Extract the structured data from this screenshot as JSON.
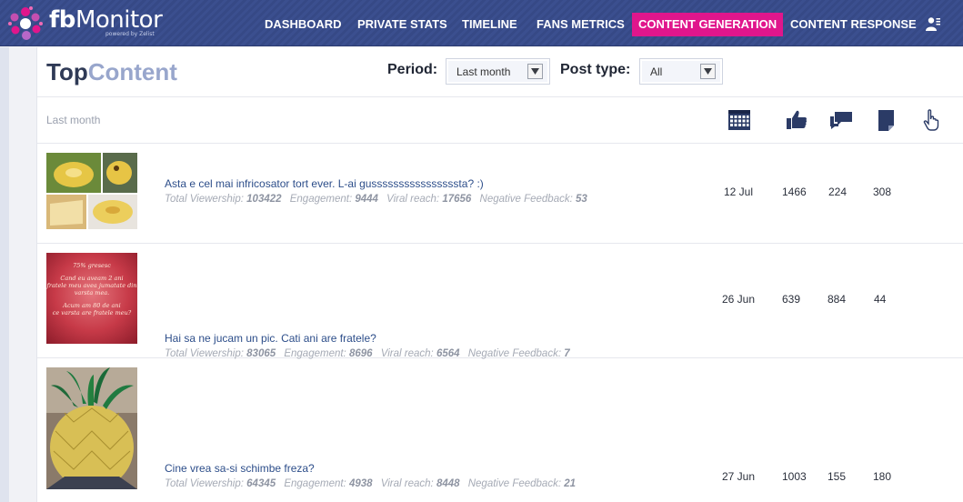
{
  "app": {
    "logo_bold": "fb",
    "logo_thin": "Monitor",
    "logo_sub": "powered by Zelist"
  },
  "nav": [
    {
      "label": "DASHBOARD"
    },
    {
      "label": "PRIVATE STATS"
    },
    {
      "label": "TIMELINE"
    },
    {
      "label": "FANS METRICS"
    },
    {
      "label": "CONTENT GENERATION",
      "active": true
    },
    {
      "label": "CONTENT RESPONSE"
    }
  ],
  "page": {
    "title_part1": "Top",
    "title_part2": "Content",
    "period_label": "Period:",
    "period_value": "Last month",
    "post_type_label": "Post type:",
    "post_type_value": "All",
    "period_text": "Last month"
  },
  "columns": [
    {
      "icon": "calendar-icon"
    },
    {
      "icon": "thumbs-up-icon"
    },
    {
      "icon": "comments-icon"
    },
    {
      "icon": "share-icon"
    },
    {
      "icon": "hand-pointer-icon"
    }
  ],
  "stat_labels": {
    "viewership": "Total Viewership:",
    "engagement": "Engagement:",
    "viral": "Viral reach:",
    "negative": "Negative Feedback:"
  },
  "rows": [
    {
      "title": "Asta e cel mai infricosator tort ever. L-ai gussssssssssssssssta? :)",
      "viewership": "103422",
      "engagement": "9444",
      "viral": "17656",
      "negative": "53",
      "date": "12 Jul",
      "likes": "1466",
      "comments": "224",
      "shares": "308"
    },
    {
      "title": "Hai sa ne jucam un pic. Cati ani are fratele?",
      "viewership": "83065",
      "engagement": "8696",
      "viral": "6564",
      "negative": "7",
      "date": "26 Jun",
      "likes": "639",
      "comments": "884",
      "shares": "44",
      "image_text": {
        "l1": "75% gresesc",
        "l2": "Cand eu aveam 2 ani",
        "l3": "fratele meu avea jumatate din",
        "l4": "varsta mea.",
        "l5": "Acum am 80 de ani",
        "l6": "ce varsta are fratele meu?"
      }
    },
    {
      "title": "Cine vrea sa-si schimbe freza?",
      "viewership": "64345",
      "engagement": "4938",
      "viral": "8448",
      "negative": "21",
      "date": "27 Jun",
      "likes": "1003",
      "comments": "155",
      "shares": "180"
    }
  ],
  "colors": {
    "nav_bg": "#3b4f8f",
    "active": "#e0168c",
    "link": "#2d4e8a",
    "title_dark": "#2f3a56",
    "title_light": "#98a6cc"
  }
}
